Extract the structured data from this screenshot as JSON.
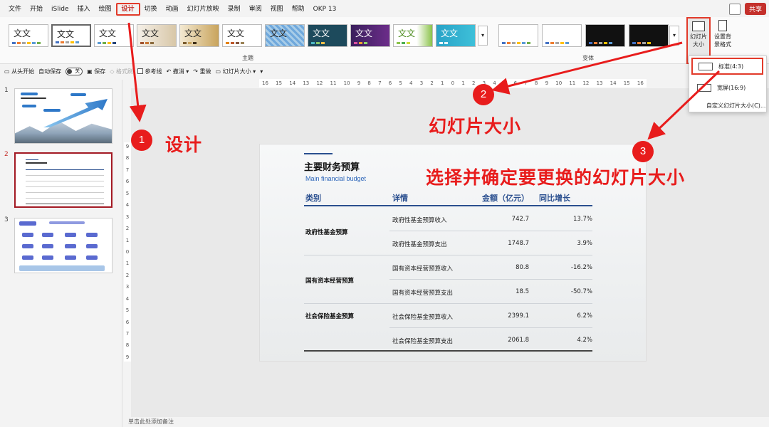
{
  "menu": {
    "items": [
      "文件",
      "开始",
      "iSlide",
      "插入",
      "绘图",
      "设计",
      "切换",
      "动画",
      "幻灯片放映",
      "录制",
      "审阅",
      "视图",
      "帮助",
      "OKP 13"
    ],
    "share": "共享"
  },
  "ribbon": {
    "theme_tile_text": "文文",
    "themes_group_label": "主题",
    "variants_group_label": "变体",
    "slide_size_button": "幻灯片大小",
    "format_bg_button": "设置背景格式"
  },
  "qat": {
    "from_start": "从头开始",
    "autosave": "自动保存",
    "autosave_state": "关",
    "save": "保存",
    "brush": "格式刷",
    "guides": "参考线",
    "undo": "撤消",
    "redo": "重做",
    "slide_size": "幻灯片大小"
  },
  "ruler": {
    "horizontal": [
      "16",
      "15",
      "14",
      "13",
      "12",
      "11",
      "10",
      "9",
      "8",
      "7",
      "6",
      "5",
      "4",
      "3",
      "2",
      "1",
      "0",
      "1",
      "2",
      "3",
      "4",
      "5",
      "6",
      "7",
      "8",
      "9",
      "10",
      "11",
      "12",
      "13",
      "14",
      "15",
      "16"
    ],
    "vertical": [
      "9",
      "8",
      "7",
      "6",
      "5",
      "4",
      "3",
      "2",
      "1",
      "0",
      "1",
      "2",
      "3",
      "4",
      "5",
      "6",
      "7",
      "8",
      "9"
    ]
  },
  "thumbnails": {
    "numbers": [
      "1",
      "2",
      "3"
    ]
  },
  "slide": {
    "title": "主要财务预算",
    "subtitle": "Main financial budget",
    "headers": [
      "类别",
      "详情",
      "金额（亿元）",
      "同比增长"
    ],
    "groups": [
      {
        "category": "政府性基金预算",
        "rows": [
          {
            "detail": "政府性基金预算收入",
            "amount": "742.7",
            "growth": "13.7%"
          },
          {
            "detail": "政府性基金预算支出",
            "amount": "1748.7",
            "growth": "3.9%"
          }
        ]
      },
      {
        "category": "国有资本经营预算",
        "rows": [
          {
            "detail": "国有资本经营预算收入",
            "amount": "80.8",
            "growth": "-16.2%"
          },
          {
            "detail": "国有资本经营预算支出",
            "amount": "18.5",
            "growth": "-50.7%"
          }
        ]
      },
      {
        "category": "社会保险基金预算",
        "rows": [
          {
            "detail": "社会保险基金预算收入",
            "amount": "2399.1",
            "growth": "6.2%"
          },
          {
            "detail": "社会保险基金预算支出",
            "amount": "2061.8",
            "growth": "4.2%"
          }
        ]
      }
    ]
  },
  "notes_placeholder": "单击此处添加备注",
  "dropdown": {
    "standard": "标准(4:3)",
    "widescreen": "宽屏(16:9)",
    "custom": "自定义幻灯片大小(C)..."
  },
  "annotations": {
    "step1": "1",
    "step1_text": "设计",
    "step2": "2",
    "step2_text": "幻灯片大小",
    "step3": "3",
    "step3_text": "选择并确定要更换的幻灯片大小",
    "color": "#e81c1c"
  }
}
